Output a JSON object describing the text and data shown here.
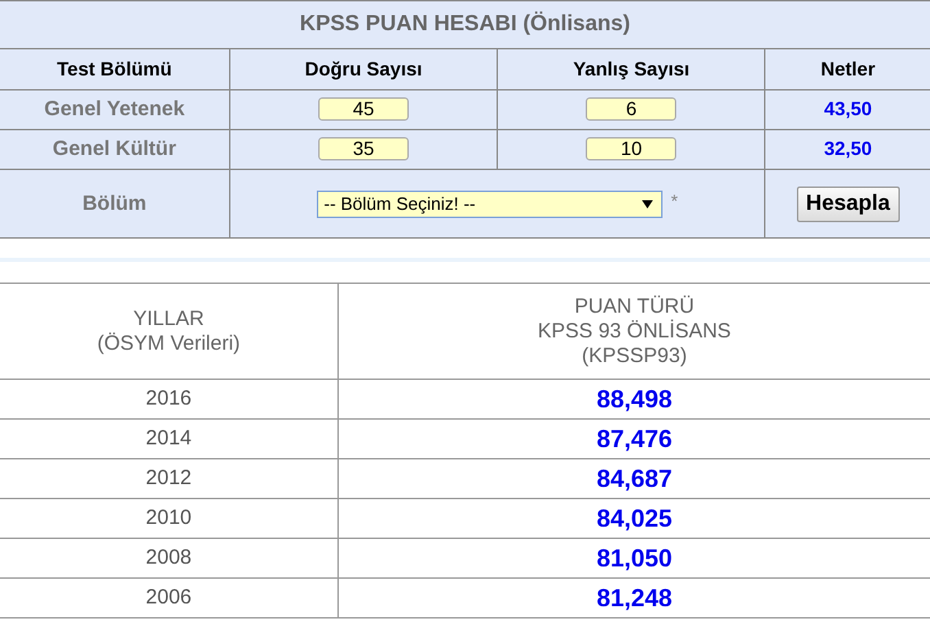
{
  "calculator": {
    "title": "KPSS PUAN HESABI (Önlisans)",
    "columns": [
      "Test Bölümü",
      "Doğru Sayısı",
      "Yanlış Sayısı",
      "Netler"
    ],
    "rows": [
      {
        "label": "Genel Yetenek",
        "correct": "45",
        "wrong": "6",
        "net": "43,50"
      },
      {
        "label": "Genel Kültür",
        "correct": "35",
        "wrong": "10",
        "net": "32,50"
      }
    ],
    "department": {
      "label": "Bölüm",
      "select": "-- Bölüm Seçiniz! --",
      "required_mark": "*"
    },
    "button": "Hesapla"
  },
  "scores": {
    "columns": [
      [
        "YILLAR",
        "(ÖSYM Verileri)"
      ],
      [
        "PUAN TÜRÜ",
        "KPSS 93 ÖNLİSANS",
        "(KPSSP93)"
      ]
    ],
    "rows": [
      {
        "year": "2016",
        "score": "88,498"
      },
      {
        "year": "2014",
        "score": "87,476"
      },
      {
        "year": "2012",
        "score": "84,687"
      },
      {
        "year": "2010",
        "score": "84,025"
      },
      {
        "year": "2008",
        "score": "81,050"
      },
      {
        "year": "2006",
        "score": "81,248"
      }
    ]
  }
}
